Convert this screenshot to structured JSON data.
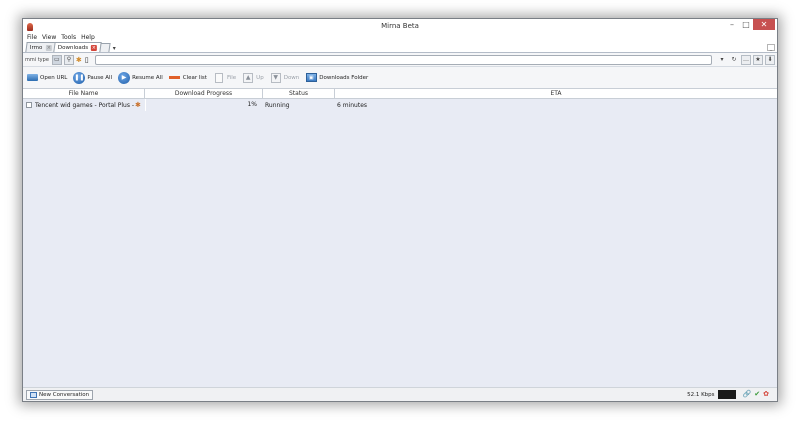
{
  "window": {
    "title": "Mirna Beta"
  },
  "menu": {
    "items": [
      "File",
      "View",
      "Tools",
      "Help"
    ]
  },
  "tabs": [
    {
      "label": "Irmo",
      "active": false
    },
    {
      "label": "Downloads",
      "active": true
    }
  ],
  "tab_overflow": "▾",
  "addressbar": {
    "type_label": "mmi type",
    "url_value": "",
    "url_placeholder": ""
  },
  "toolbar": {
    "open_url": "Open URL",
    "pause_all": "Pause All",
    "resume_all": "Resume All",
    "clear_list": "Clear list",
    "file": "File",
    "up": "Up",
    "down": "Down",
    "downloads_folder": "Downloads Folder"
  },
  "table": {
    "headers": {
      "name": "File Name",
      "progress": "Download Progress",
      "status": "Status",
      "eta": "ETA"
    },
    "rows": [
      {
        "name": "Tencent wid games - Portal Plus - Game ...",
        "progress_text": "1%",
        "progress_fraction": 0.01,
        "status": "Running",
        "eta": "6 minutes"
      }
    ]
  },
  "statusbar": {
    "new_conversation": "New Conversation",
    "speed": "52.1 Kbps"
  },
  "colors": {
    "accent": "#2b6cb0",
    "close": "#c75050",
    "list_bg": "#e8ebf4"
  }
}
